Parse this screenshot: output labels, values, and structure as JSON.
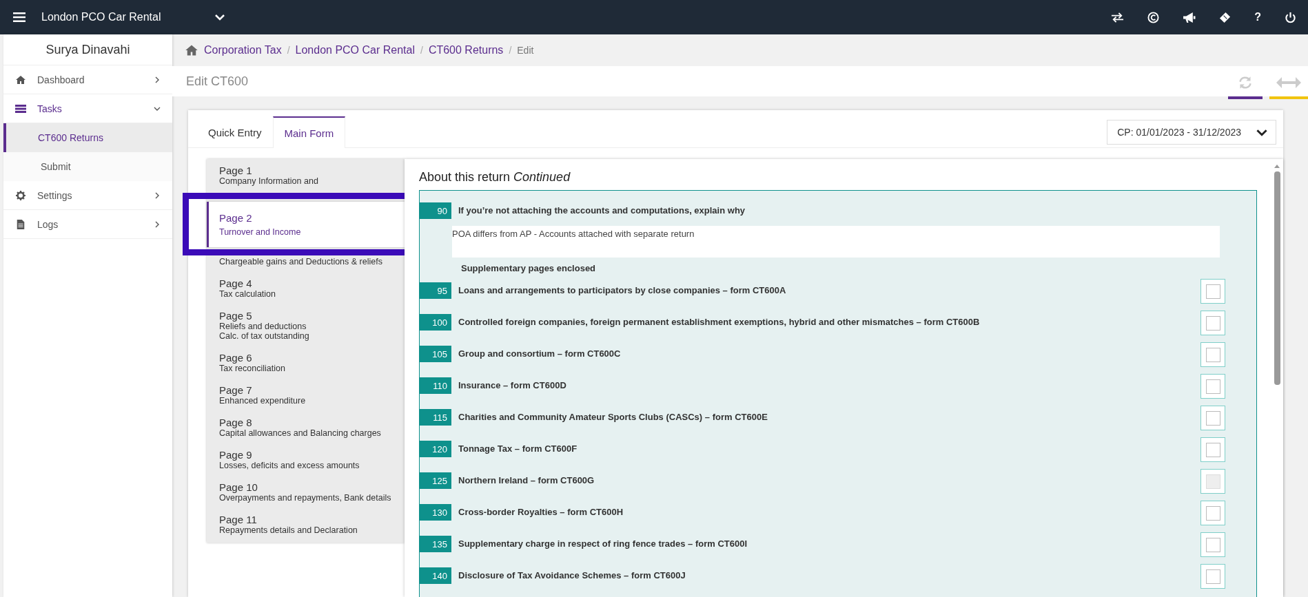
{
  "topbar": {
    "company": "London PCO Car Rental",
    "help": "?"
  },
  "sidebar": {
    "user": "Surya Dinavahi",
    "items": [
      {
        "label": "Dashboard",
        "expanded": false
      },
      {
        "label": "Tasks",
        "expanded": true,
        "children": [
          {
            "label": "CT600 Returns",
            "selected": true
          },
          {
            "label": "Submit",
            "selected": false
          }
        ]
      },
      {
        "label": "Settings",
        "expanded": false
      },
      {
        "label": "Logs",
        "expanded": false
      }
    ]
  },
  "breadcrumb": [
    {
      "label": "Corporation Tax",
      "separator": "/"
    },
    {
      "label": "London PCO Car Rental",
      "separator": "/"
    },
    {
      "label": "CT600 Returns",
      "separator": "/"
    },
    {
      "label": "Edit"
    }
  ],
  "page_title": "Edit CT600",
  "tabs": [
    {
      "label": "Quick Entry",
      "selected": false
    },
    {
      "label": "Main Form",
      "selected": true
    }
  ],
  "period": "CP: 01/01/2023 - 31/12/2023",
  "pages": [
    {
      "title": "Page 1",
      "subtitle": [
        "Company Information and"
      ],
      "selected": false,
      "highlighted": false
    },
    {
      "title": "Page 2",
      "subtitle": [
        "Turnover and Income"
      ],
      "selected": true,
      "highlighted": true
    },
    {
      "subtitle": [
        "Chargeable gains and Deductions & reliefs"
      ],
      "selected": false,
      "highlighted": false
    },
    {
      "title": "Page 4",
      "subtitle": [
        "Tax calculation"
      ],
      "selected": false,
      "highlighted": false
    },
    {
      "title": "Page 5",
      "subtitle": [
        "Reliefs and deductions",
        "Calc. of tax outstanding"
      ],
      "selected": false,
      "highlighted": false
    },
    {
      "title": "Page 6",
      "subtitle": [
        "Tax reconciliation"
      ],
      "selected": false,
      "highlighted": false
    },
    {
      "title": "Page 7",
      "subtitle": [
        "Enhanced expenditure"
      ],
      "selected": false,
      "highlighted": false
    },
    {
      "title": "Page 8",
      "subtitle": [
        "Capital allowances and Balancing charges"
      ],
      "selected": false,
      "highlighted": false
    },
    {
      "title": "Page 9",
      "subtitle": [
        "Losses, deficits and excess amounts"
      ],
      "selected": false,
      "highlighted": false
    },
    {
      "title": "Page 10",
      "subtitle": [
        "Overpayments and repayments, Bank details"
      ],
      "selected": false,
      "highlighted": false
    },
    {
      "title": "Page 11",
      "subtitle": [
        "Repayments details and Declaration"
      ],
      "selected": false,
      "highlighted": false
    }
  ],
  "section": {
    "title": "About this return *Continued*"
  },
  "fields": [
    {
      "kind": "text",
      "number": "90",
      "label": "If you’re not attaching the accounts and computations, explain why",
      "value": "POA differs from AP - Accounts attached with separate return"
    },
    {
      "kind": "heading",
      "label": "Supplementary pages enclosed"
    },
    {
      "kind": "checkbox",
      "number": "95",
      "label": "Loans and arrangements to participators by close companies – form CT600A",
      "checked": false,
      "disabled": false
    },
    {
      "kind": "checkbox",
      "number": "100",
      "label": "Controlled foreign companies, foreign permanent establishment exemptions, hybrid and other mismatches – form CT600B",
      "checked": false,
      "disabled": false
    },
    {
      "kind": "checkbox",
      "number": "105",
      "label": "Group and consortium – form CT600C",
      "checked": false,
      "disabled": false
    },
    {
      "kind": "checkbox",
      "number": "110",
      "label": "Insurance – form CT600D",
      "checked": false,
      "disabled": false
    },
    {
      "kind": "checkbox",
      "number": "115",
      "label": "Charities and Community Amateur Sports Clubs (CASCs) – form CT600E",
      "checked": false,
      "disabled": false
    },
    {
      "kind": "checkbox",
      "number": "120",
      "label": "Tonnage Tax – form CT600F",
      "checked": false,
      "disabled": false
    },
    {
      "kind": "checkbox",
      "number": "125",
      "label": "Northern Ireland – form CT600G",
      "checked": false,
      "disabled": true
    },
    {
      "kind": "checkbox",
      "number": "130",
      "label": "Cross-border Royalties – form CT600H",
      "checked": false,
      "disabled": false
    },
    {
      "kind": "checkbox",
      "number": "135",
      "label": "Supplementary charge in respect of ring fence trades – form CT600I",
      "checked": false,
      "disabled": false
    },
    {
      "kind": "checkbox",
      "number": "140",
      "label": "Disclosure of Tax Avoidance Schemes – form CT600J",
      "checked": false,
      "disabled": false
    }
  ]
}
